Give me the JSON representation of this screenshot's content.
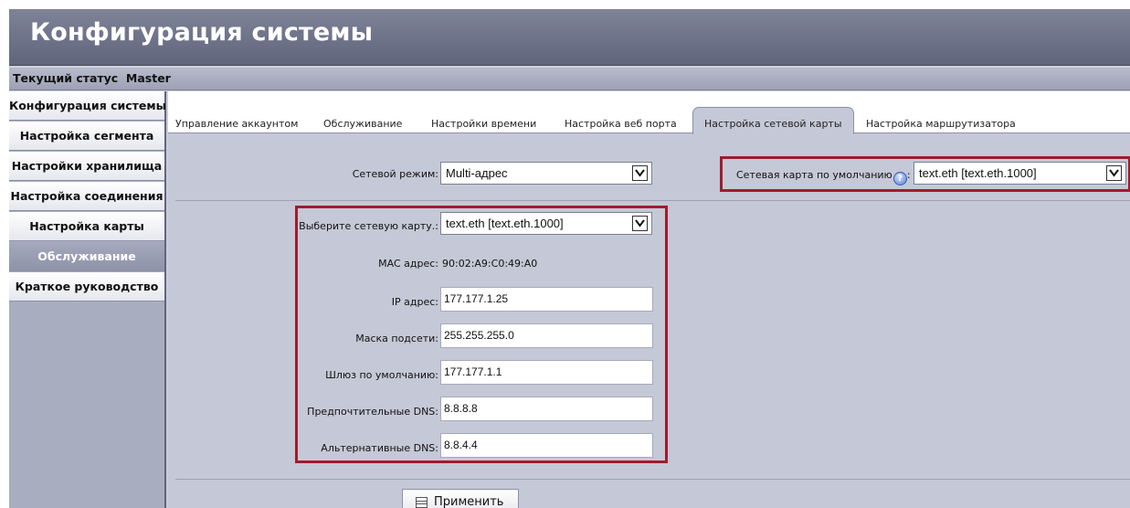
{
  "window": {
    "title": "Конфигурация системы"
  },
  "status": {
    "text": "Текущий статус  Master"
  },
  "sidebar": {
    "items": [
      {
        "label": "Конфигурация системы"
      },
      {
        "label": "Настройка сегмента"
      },
      {
        "label": "Настройки хранилища"
      },
      {
        "label": "Настройка соединения"
      },
      {
        "label": "Настройка карты"
      },
      {
        "label": "Обслуживание",
        "active": true
      },
      {
        "label": "Краткое руководство"
      }
    ]
  },
  "tabs": [
    {
      "label": "Управление аккаунтом"
    },
    {
      "label": "Обслуживание"
    },
    {
      "label": "Настройки времени"
    },
    {
      "label": "Настройка веб порта"
    },
    {
      "label": "Настройка сетевой карты",
      "active": true
    },
    {
      "label": "Настройка маршрутизатора"
    }
  ],
  "network": {
    "mode_label": "Сетевой режим:",
    "mode_value": "Multi-адрес",
    "default_nic_label": "Сетевая карта по умолчанию",
    "default_nic_suffix": ":",
    "default_nic_value": "text.eth [text.eth.1000]"
  },
  "nic": {
    "select_label": "Выберите сетевую карту.:",
    "select_value": "text.eth [text.eth.1000]",
    "mac_label": "MAC адрес:",
    "mac_value": "90:02:A9:C0:49:A0",
    "ip_label": "IP адрес:",
    "ip_value": "177.177.1.25",
    "mask_label": "Маска подсети:",
    "mask_value": "255.255.255.0",
    "gateway_label": "Шлюз по умолчанию:",
    "gateway_value": "177.177.1.1",
    "dns1_label": "Предпочтительные DNS:",
    "dns1_value": "8.8.8.8",
    "dns2_label": "Альтернативные DNS:",
    "dns2_value": "8.8.4.4"
  },
  "actions": {
    "apply_label": "Применить"
  },
  "colors": {
    "title_bar": "#6a6f85",
    "sidebar_active": "#9a9fb3",
    "content_bg": "#c5c8d6",
    "highlight_border": "#a01c2b"
  }
}
